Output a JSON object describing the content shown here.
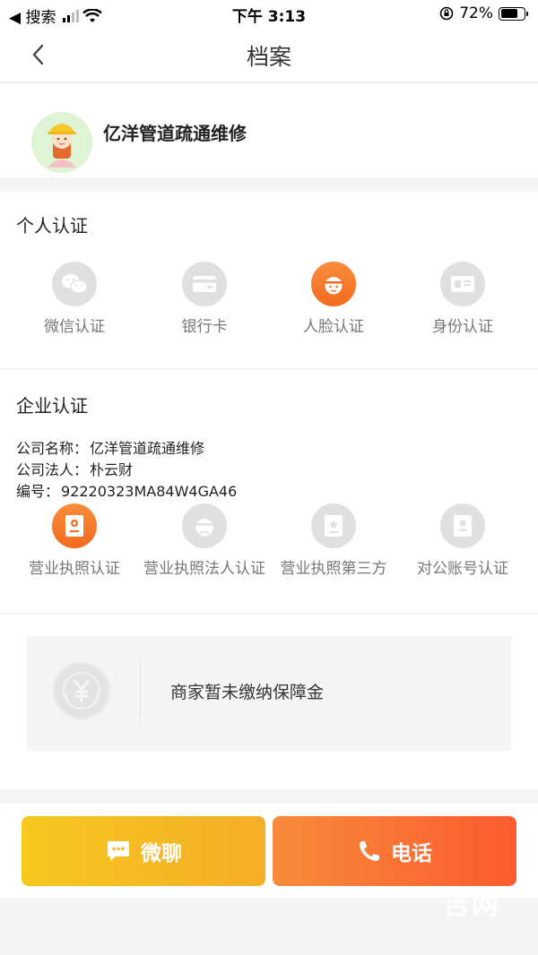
{
  "status_bar": {
    "back_app": "◀ 搜索",
    "time": "下午 3:13",
    "battery": "72%",
    "battery_level": 0.72
  },
  "nav": {
    "title": "档案"
  },
  "profile": {
    "name": "亿洋管道疏通维修"
  },
  "personal_cert": {
    "title": "个人认证",
    "items": [
      {
        "label": "微信认证",
        "icon": "wechat-icon",
        "active": false
      },
      {
        "label": "银行卡",
        "icon": "bank-card-icon",
        "active": false
      },
      {
        "label": "人脸认证",
        "icon": "face-icon",
        "active": true
      },
      {
        "label": "身份认证",
        "icon": "id-card-icon",
        "active": false
      }
    ]
  },
  "enterprise_cert": {
    "title": "企业认证",
    "company_name_label": "公司名称：",
    "company_name": "亿洋管道疏通维修",
    "legal_person_label": "公司法人：",
    "legal_person": "朴云财",
    "number_label": "编号：",
    "number": "92220323MA84W4GA46",
    "items": [
      {
        "label": "营业执照认证",
        "icon": "license-icon",
        "active": true
      },
      {
        "label": "营业执照法人认证",
        "icon": "license-person-icon",
        "active": false
      },
      {
        "label": "营业执照第三方",
        "icon": "license-third-party-icon",
        "active": false
      },
      {
        "label": "对公账号认证",
        "icon": "corporate-account-icon",
        "active": false
      }
    ]
  },
  "deposit": {
    "text": "商家暂未缴纳保障金",
    "icon": "yuan-coin-icon"
  },
  "actions": {
    "chat_label": "微聊",
    "phone_label": "电话"
  },
  "watermark": "吉网",
  "colors": {
    "accent": "#f36a1e",
    "chat_button": "#f4b828",
    "phone_button": "#fb5b2e"
  }
}
